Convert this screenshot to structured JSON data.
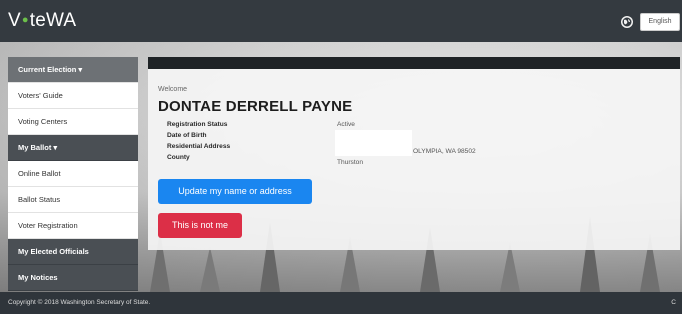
{
  "header": {
    "logo_part1": "V",
    "logo_part2": "teWA",
    "language": "English"
  },
  "sidebar": {
    "items": [
      {
        "label": "Current Election ▾"
      },
      {
        "label": "Voters' Guide"
      },
      {
        "label": "Voting Centers"
      },
      {
        "label": "My Ballot ▾"
      },
      {
        "label": "Online Ballot"
      },
      {
        "label": "Ballot Status"
      },
      {
        "label": "Voter Registration"
      },
      {
        "label": "My Elected Officials"
      },
      {
        "label": "My Notices"
      }
    ]
  },
  "card": {
    "welcome": "Welcome",
    "name": "DONTAE DERRELL PAYNE",
    "rows": [
      {
        "label": "Registration Status",
        "value": "Active"
      },
      {
        "label": "Date of Birth",
        "value": ""
      },
      {
        "label": "Residential Address",
        "value": "OLYMPIA, WA 98502"
      },
      {
        "label": "County",
        "value": "Thurston"
      }
    ],
    "update_button": "Update my name or address",
    "not_me_button": "This is not me"
  },
  "footer": {
    "copyright": "Copyright © 2018 Washington Secretary of State.",
    "right_text": "C"
  },
  "colors": {
    "topbar": "#343a40",
    "logo_dot": "#6cc04a",
    "primary_button": "#1a86f0",
    "danger_button": "#dc2f47",
    "footer": "#2f353b"
  }
}
